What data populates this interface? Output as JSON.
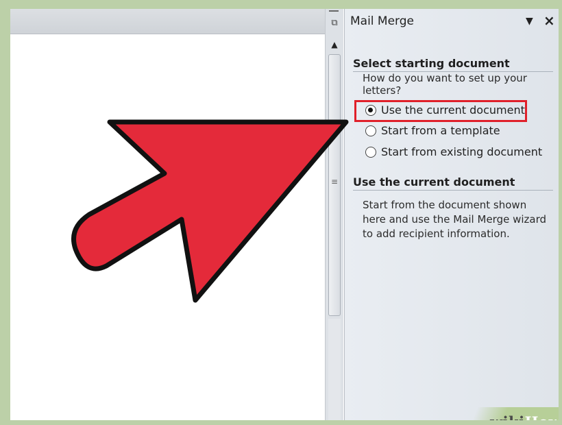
{
  "task_pane": {
    "title": "Mail Merge",
    "menu_icon": "dropdown-triangle",
    "close_icon": "close-x"
  },
  "section1": {
    "title": "Select starting document",
    "prompt": "How do you want to set up your letters?"
  },
  "options": [
    {
      "label": "Use the current document",
      "selected": true
    },
    {
      "label": "Start from a template",
      "selected": false
    },
    {
      "label": "Start from existing document",
      "selected": false
    }
  ],
  "section2": {
    "title": "Use the current document",
    "description": "Start from the document shown here and use the Mail Merge wizard to add recipient information."
  },
  "overlay": {
    "arrow_color": "#e42a3a",
    "highlight_color": "#e0202a"
  },
  "watermark": {
    "part1": "wiki",
    "part2": "How"
  }
}
